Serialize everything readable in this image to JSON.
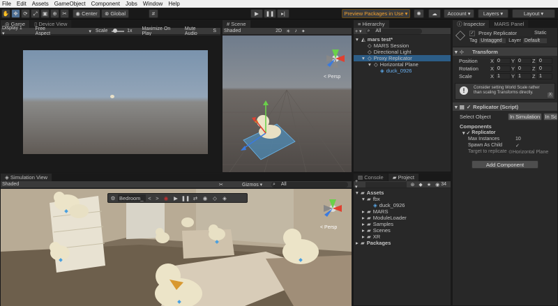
{
  "menu": [
    "File",
    "Edit",
    "Assets",
    "GameObject",
    "Component",
    "Jobs",
    "Window",
    "Help"
  ],
  "toolbar": {
    "pivot": "Center",
    "space": "Global",
    "preview_packages": "Preview Packages in Use ▾",
    "account": "Account ▾",
    "layers": "Layers ▾",
    "layout": "Layout ▾"
  },
  "game": {
    "tabs": [
      "Game",
      "Device View"
    ],
    "display": "Display 1 ▾",
    "aspect": "Free Aspect",
    "scale_label": "Scale",
    "scale_value": "1x",
    "maximize": "Maximize On Play",
    "mute": "Mute Audio",
    "stats": "S"
  },
  "scene": {
    "tab": "Scene",
    "shading": "Shaded",
    "mode_2d": "2D",
    "persp": "< Persp"
  },
  "simulation": {
    "tab": "Simulation View",
    "shading": "Shaded",
    "gizmos": "Gizmos ▾",
    "search_all": "All",
    "environment": "Bedroom_",
    "persp": "< Persp"
  },
  "hierarchy": {
    "tab": "Hierarchy",
    "search": "All",
    "items": [
      {
        "label": "mars test*",
        "indent": 0,
        "expanded": true,
        "kind": "scene"
      },
      {
        "label": "MARS Session",
        "indent": 1,
        "kind": "object"
      },
      {
        "label": "Directional Light",
        "indent": 1,
        "kind": "object"
      },
      {
        "label": "Proxy Replicator",
        "indent": 1,
        "expanded": true,
        "kind": "object",
        "selected": true
      },
      {
        "label": "Horizontal Plane",
        "indent": 2,
        "expanded": true,
        "kind": "object"
      },
      {
        "label": "duck_0926",
        "indent": 3,
        "kind": "prefab"
      }
    ]
  },
  "project": {
    "tabs": [
      "Console",
      "Project"
    ],
    "count": "34",
    "tree": [
      {
        "label": "Assets",
        "indent": 0,
        "bold": true,
        "expanded": true
      },
      {
        "label": "fbx",
        "indent": 1,
        "expanded": true
      },
      {
        "label": "duck_0926",
        "indent": 2,
        "prefab": true
      },
      {
        "label": "MARS",
        "indent": 1
      },
      {
        "label": "ModuleLoader",
        "indent": 1
      },
      {
        "label": "Samples",
        "indent": 1
      },
      {
        "label": "Scenes",
        "indent": 1
      },
      {
        "label": "XR",
        "indent": 1
      },
      {
        "label": "Packages",
        "indent": 0,
        "bold": true
      }
    ]
  },
  "inspector": {
    "tabs": [
      "Inspector",
      "MARS Panel"
    ],
    "object_name": "Proxy Replicator",
    "static": "Static",
    "tag_label": "Tag",
    "tag_value": "Untagged",
    "layer_label": "Layer",
    "layer_value": "Default",
    "transform": {
      "title": "Transform",
      "rows": [
        {
          "label": "Position",
          "x": "0",
          "y": "0",
          "z": "0"
        },
        {
          "label": "Rotation",
          "x": "0",
          "y": "0",
          "z": "0"
        },
        {
          "label": "Scale",
          "x": "1",
          "y": "1",
          "z": "1"
        }
      ]
    },
    "warning": "Consider setting World Scale rather than scaling Transforms directly.",
    "warning_close": "X",
    "replicator": {
      "title": "Replicator (Script)",
      "select_object": "Select Object",
      "in_simulation": "In Simulation",
      "in_scene": "In Sc",
      "components": "Components",
      "sub_title": "Replicator",
      "max_instances_label": "Max Instances",
      "max_instances_value": "10",
      "spawn_child_label": "Spawn As Child",
      "target_label": "Target to replicate",
      "target_value": "Horizontal Plane"
    },
    "add_component": "Add Component"
  },
  "colors": {
    "accent": "#3a72b0",
    "selected_row": "#2c5d87",
    "warning_orange": "#f0a030"
  }
}
